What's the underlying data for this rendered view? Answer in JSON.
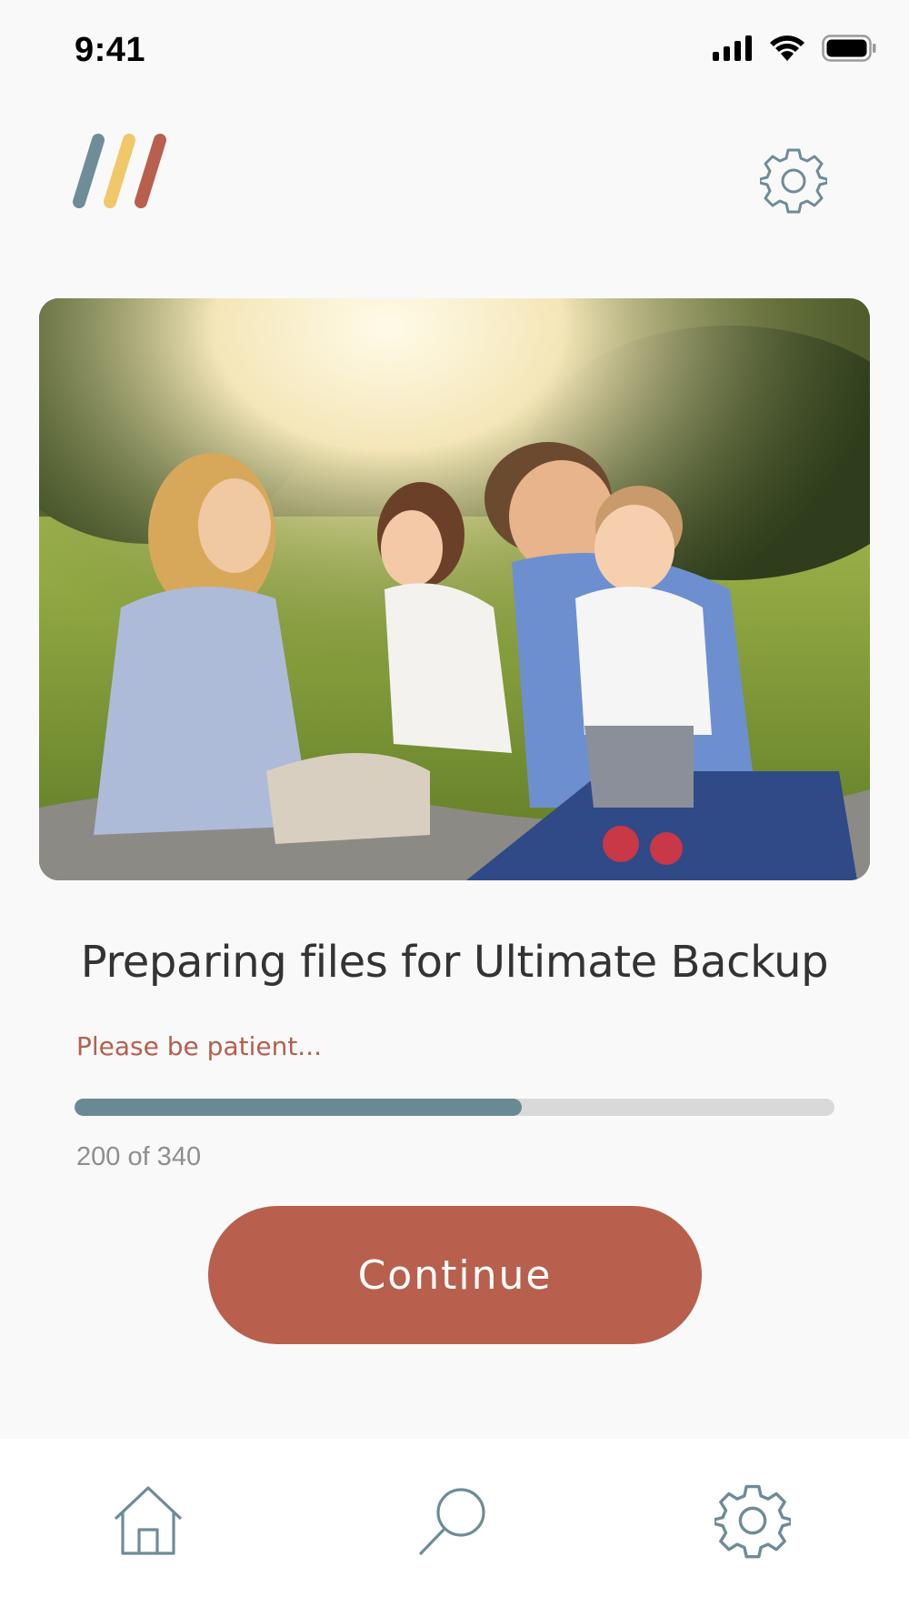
{
  "status_bar": {
    "time": "9:41",
    "icons": [
      "cellular-signal-icon",
      "wifi-icon",
      "battery-icon"
    ]
  },
  "header": {
    "logo": "app-logo-three-stripes",
    "settings_icon": "gear-icon"
  },
  "hero_image": {
    "subject": "family-photo"
  },
  "content": {
    "headline": "Preparing files for Ultimate Backup",
    "subtext": "Please be patient...",
    "progress": {
      "current": 200,
      "total": 340,
      "fraction": 0.588,
      "label": "200 of 340"
    }
  },
  "actions": {
    "continue_label": "Continue"
  },
  "bottom_nav": {
    "items": [
      {
        "icon": "home-icon"
      },
      {
        "icon": "search-icon"
      },
      {
        "icon": "gear-icon"
      }
    ]
  },
  "colors": {
    "accent": "#b8604d",
    "progress_fill": "#6a8a93",
    "progress_track": "#d9d9d9",
    "headline": "#333333",
    "subtext": "#b5604e",
    "icon_stroke": "#6e8c97",
    "logo_stripes": [
      "#6f8d98",
      "#f0c86a",
      "#b8604d"
    ]
  }
}
